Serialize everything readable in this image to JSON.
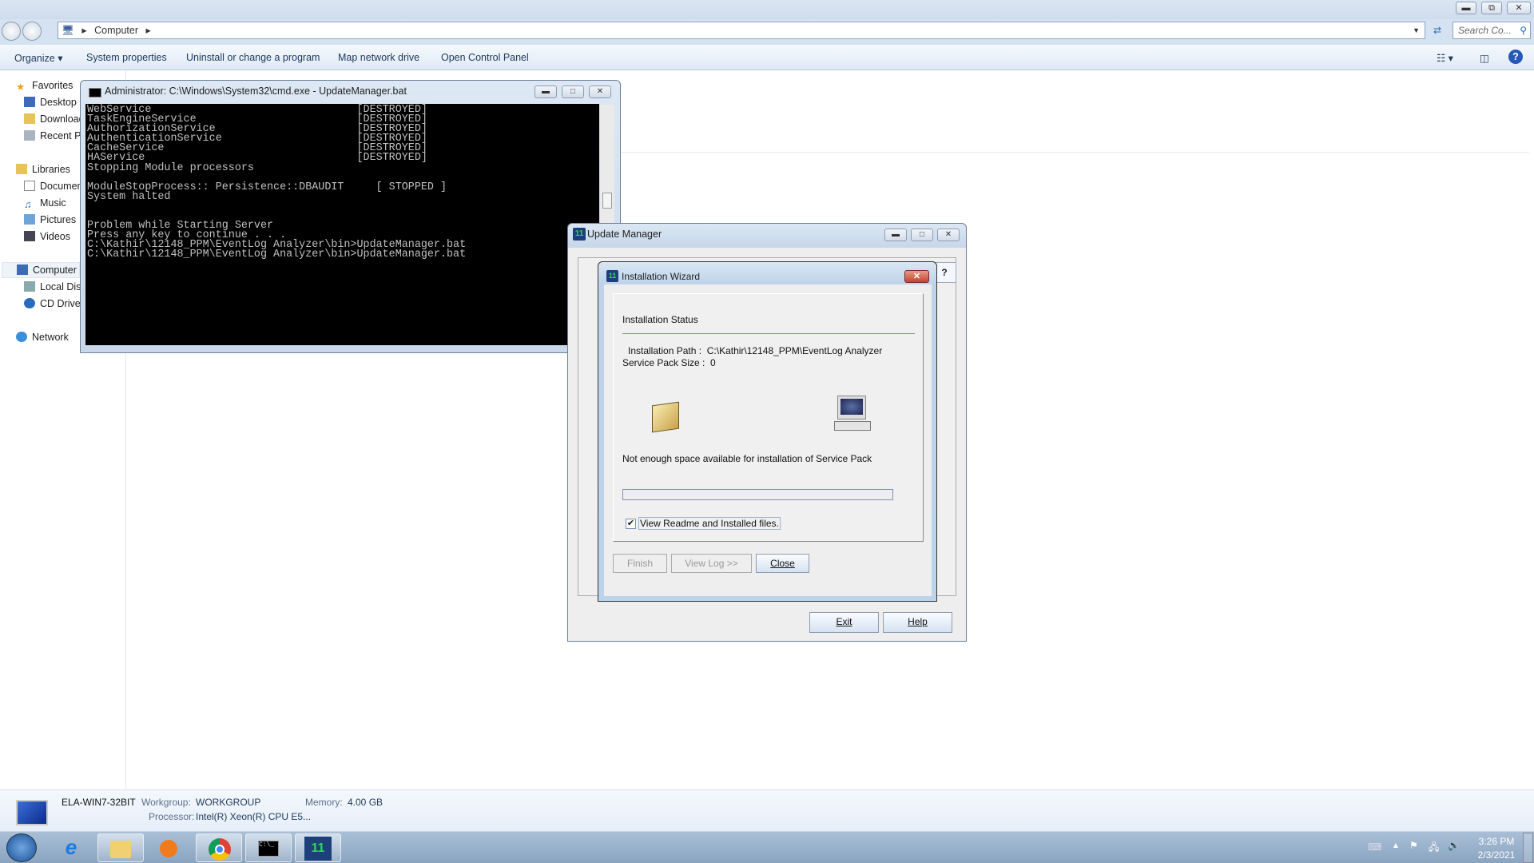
{
  "explorer": {
    "address_crumb": "Computer",
    "search_placeholder": "Search Co...",
    "toolbar": [
      "Organize",
      "System properties",
      "Uninstall or change a program",
      "Map network drive",
      "Open Control Panel"
    ],
    "nav": {
      "favorites": "Favorites",
      "desktop": "Desktop",
      "downloads": "Downloads",
      "recent": "Recent Places",
      "libraries": "Libraries",
      "documents": "Documents",
      "music": "Music",
      "pictures": "Pictures",
      "videos": "Videos",
      "computer": "Computer",
      "local_disk": "Local Disk",
      "cd_drive": "CD Drive",
      "network": "Network"
    },
    "status": {
      "computer_name": "ELA-WIN7-32BIT",
      "workgroup_label": "Workgroup:",
      "workgroup": "WORKGROUP",
      "memory_label": "Memory:",
      "memory": "4.00 GB",
      "processor_label": "Processor:",
      "processor": "Intel(R) Xeon(R) CPU E5..."
    }
  },
  "cmd": {
    "title": "Administrator: C:\\Windows\\System32\\cmd.exe - UpdateManager.bat",
    "output": "WebService                                [DESTROYED]\nTaskEngineService                         [DESTROYED]\nAuthorizationService                      [DESTROYED]\nAuthenticationService                     [DESTROYED]\nCacheService                              [DESTROYED]\nHAService                                 [DESTROYED]\nStopping Module processors\n\nModuleStopProcess:: Persistence::DBAUDIT     [ STOPPED ]\nSystem halted\n\n\nProblem while Starting Server\nPress any key to continue . . .\nC:\\Kathir\\12148_PPM\\EventLog Analyzer\\bin>UpdateManager.bat\nC:\\Kathir\\12148_PPM\\EventLog Analyzer\\bin>UpdateManager.bat"
  },
  "update_manager": {
    "title": "Update Manager",
    "exit": "Exit",
    "help": "Help"
  },
  "wizard": {
    "title": "Installation Wizard",
    "heading": "Installation Status",
    "path_label": "Installation Path :",
    "path": "C:\\Kathir\\12148_PPM\\EventLog Analyzer",
    "size_label": "Service Pack Size :",
    "size": "0",
    "message": "Not enough space available for installation of Service Pack",
    "progress_percent": 0,
    "checkbox_label": "View Readme and Installed files.",
    "checkbox_checked": true,
    "finish": "Finish",
    "view_log": "View Log >>",
    "close": "Close"
  },
  "tray": {
    "time": "3:26 PM",
    "date": "2/3/2021"
  }
}
